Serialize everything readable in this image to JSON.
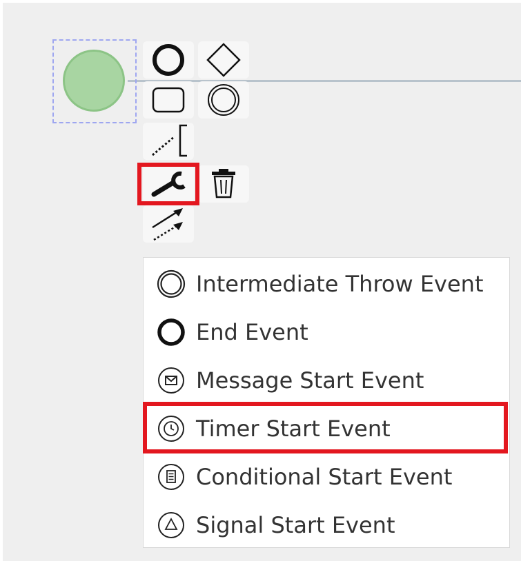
{
  "context_pad": {
    "tools": [
      {
        "name": "end-event",
        "icon": "bold-circle-icon"
      },
      {
        "name": "gateway",
        "icon": "diamond-icon"
      },
      {
        "name": "task",
        "icon": "rounded-rect-icon"
      },
      {
        "name": "intermediate-event",
        "icon": "double-circle-icon"
      },
      {
        "name": "text-annotation",
        "icon": "annotation-icon"
      },
      {
        "name": "change-type",
        "icon": "wrench-icon"
      },
      {
        "name": "delete",
        "icon": "trash-icon"
      },
      {
        "name": "connect",
        "icon": "connect-arrows-icon"
      }
    ]
  },
  "replace_menu": {
    "items": [
      {
        "label": "Intermediate Throw Event",
        "icon": "double-circle-icon"
      },
      {
        "label": "End Event",
        "icon": "bold-circle-icon"
      },
      {
        "label": "Message Start Event",
        "icon": "envelope-circle-icon"
      },
      {
        "label": "Timer Start Event",
        "icon": "clock-circle-icon"
      },
      {
        "label": "Conditional Start Event",
        "icon": "list-circle-icon"
      },
      {
        "label": "Signal Start Event",
        "icon": "triangle-circle-icon"
      }
    ]
  },
  "colors": {
    "highlight": "#e3171f",
    "start_event_fill": "#a8d5a2",
    "start_event_stroke": "#8cc486",
    "selection": "#9ea6f0",
    "canvas": "#efefef"
  }
}
